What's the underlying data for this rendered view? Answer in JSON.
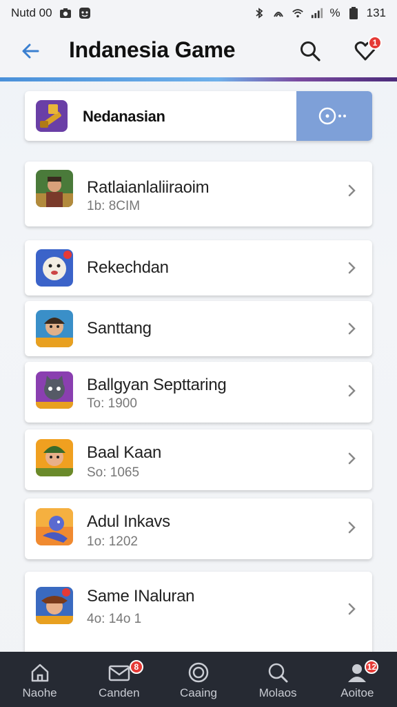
{
  "status_bar": {
    "left_text": "Nutd 00",
    "battery_text": "%",
    "time": "131"
  },
  "header": {
    "title": "Indanesia Game",
    "notification_count": "1"
  },
  "featured": {
    "name": "Nedanasian"
  },
  "games": [
    {
      "name": "Ratlaianlaliiraoim",
      "sub": "1b: 8CIM"
    },
    {
      "name": "Rekechdan",
      "sub": ""
    },
    {
      "name": "Santtang",
      "sub": ""
    },
    {
      "name": "Ballgyan Septtaring",
      "sub": "To: 1900"
    },
    {
      "name": "Baal Kaan",
      "sub": "So: 1065"
    },
    {
      "name": "Adul Inkavs",
      "sub": "1o: 1202"
    },
    {
      "name": "Same INaluran",
      "sub": "4o: 14o 1"
    }
  ],
  "bottom_nav": [
    {
      "label": "Naohe",
      "icon": "home-icon",
      "badge": ""
    },
    {
      "label": "Canden",
      "icon": "mail-icon",
      "badge": "8"
    },
    {
      "label": "Caaing",
      "icon": "target-icon",
      "badge": ""
    },
    {
      "label": "Molaos",
      "icon": "search-icon",
      "badge": ""
    },
    {
      "label": "Aoitoe",
      "icon": "profile-icon",
      "badge": "12"
    }
  ],
  "colors": {
    "accent": "#4a90d9",
    "featured_button": "#7ea0d8",
    "badge": "#e53935",
    "nav_background": "#262a33"
  }
}
